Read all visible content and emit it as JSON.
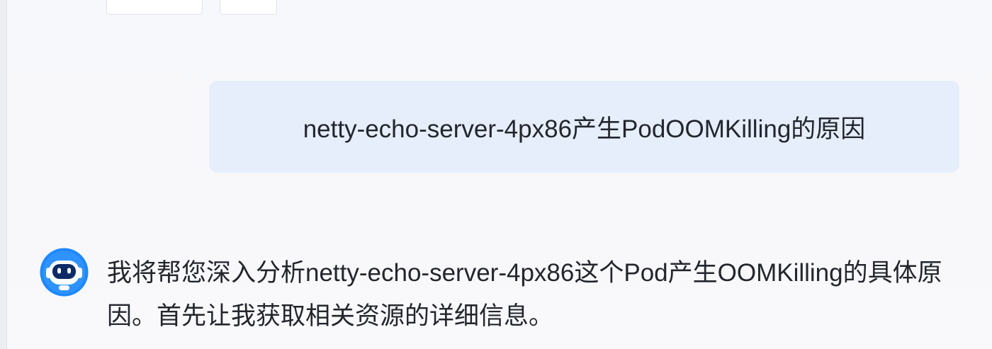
{
  "chat": {
    "user_message": "netty-echo-server-4px86产生PodOOMKilling的原因",
    "assistant_message": "我将帮您深入分析netty-echo-server-4px86这个Pod产生OOMKilling的具体原因。首先让我获取相关资源的详细信息。",
    "assistant_avatar_icon": "robot-icon"
  },
  "colors": {
    "user_bubble_bg": "#e6eefb",
    "avatar_blue": "#1e88ff",
    "text": "#23262d"
  }
}
